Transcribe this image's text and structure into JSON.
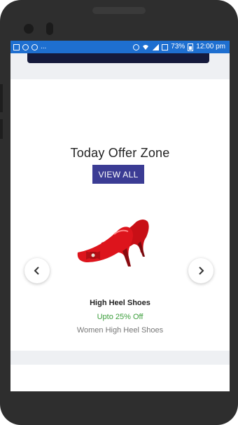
{
  "status_bar": {
    "left_text": "...",
    "battery": "73%",
    "time": "12:00 pm"
  },
  "offer_section": {
    "title": "Today Offer Zone",
    "view_all_label": "VIEW ALL"
  },
  "product": {
    "image_icon": "red-high-heel-shoes",
    "name": "High Heel Shoes",
    "discount": "Upto 25% Off",
    "description": "Women High Heel Shoes"
  },
  "carousel": {
    "prev_icon": "chevron-left-icon",
    "next_icon": "chevron-right-icon"
  },
  "colors": {
    "status_bar": "#1e6fd0",
    "view_all_button": "#3b3c94",
    "discount_text": "#3a9d3a"
  }
}
